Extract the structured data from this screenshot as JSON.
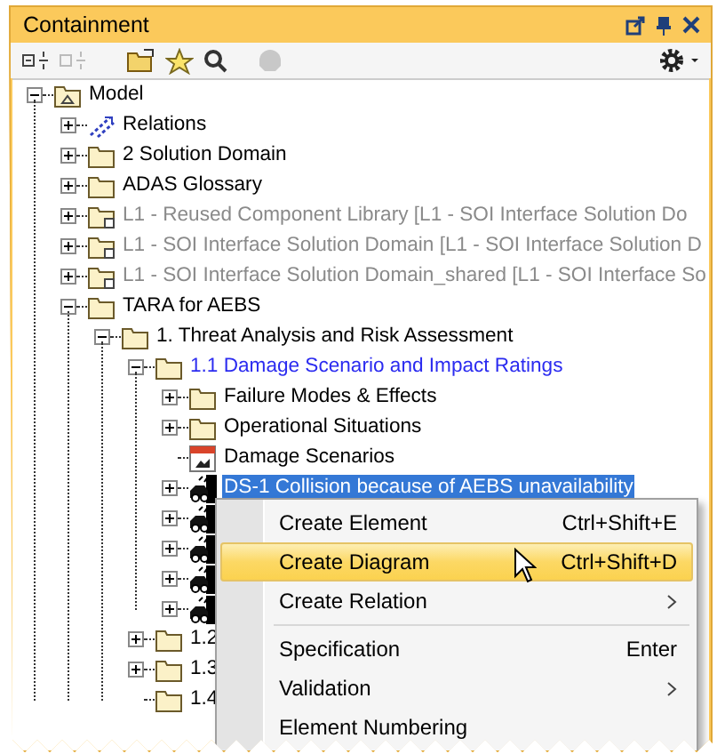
{
  "window": {
    "title": "Containment"
  },
  "tree": [
    {
      "label": "Model",
      "kind": "model",
      "expanded": true,
      "selected": false,
      "greyed": false,
      "emphasized": false,
      "children": [
        {
          "label": "Relations",
          "kind": "relations",
          "expanded": false,
          "selected": false,
          "greyed": false,
          "emphasized": false
        },
        {
          "label": "2 Solution Domain",
          "kind": "folder",
          "expanded": false,
          "selected": false,
          "greyed": false,
          "emphasized": false
        },
        {
          "label": "ADAS Glossary",
          "kind": "folder",
          "expanded": false,
          "selected": false,
          "greyed": false,
          "emphasized": false
        },
        {
          "label": "L1 - Reused Component Library [L1 - SOI Interface Solution Do",
          "kind": "shared-folder",
          "expanded": false,
          "selected": false,
          "greyed": true,
          "emphasized": false
        },
        {
          "label": "L1 - SOI Interface Solution Domain [L1 - SOI Interface Solution D",
          "kind": "shared-folder",
          "expanded": false,
          "selected": false,
          "greyed": true,
          "emphasized": false
        },
        {
          "label": "L1 - SOI Interface Solution Domain_shared [L1 - SOI Interface So",
          "kind": "shared-folder",
          "expanded": false,
          "selected": false,
          "greyed": true,
          "emphasized": false
        },
        {
          "label": "TARA for AEBS",
          "kind": "folder",
          "expanded": true,
          "selected": false,
          "greyed": false,
          "emphasized": false,
          "children": [
            {
              "label": "1. Threat Analysis and Risk Assessment",
              "kind": "folder",
              "expanded": true,
              "selected": false,
              "greyed": false,
              "emphasized": false,
              "children": [
                {
                  "label": "1.1 Damage Scenario and Impact Ratings",
                  "kind": "folder",
                  "expanded": true,
                  "selected": false,
                  "greyed": false,
                  "emphasized": true,
                  "children": [
                    {
                      "label": "Failure Modes & Effects",
                      "kind": "folder",
                      "expanded": false,
                      "selected": false,
                      "greyed": false,
                      "emphasized": false
                    },
                    {
                      "label": "Operational Situations",
                      "kind": "folder",
                      "expanded": false,
                      "selected": false,
                      "greyed": false,
                      "emphasized": false
                    },
                    {
                      "label": "Damage Scenarios",
                      "kind": "table",
                      "selected": false,
                      "greyed": false,
                      "emphasized": false
                    },
                    {
                      "label": "DS-1 Collision because of AEBS unavailability",
                      "kind": "scenario",
                      "expanded": false,
                      "selected": true,
                      "greyed": false,
                      "emphasized": false
                    },
                    {
                      "kind": "scenario",
                      "expanded": false,
                      "selected": false
                    },
                    {
                      "kind": "scenario",
                      "expanded": false,
                      "selected": false
                    },
                    {
                      "kind": "scenario",
                      "expanded": false,
                      "selected": false
                    },
                    {
                      "kind": "scenario",
                      "expanded": false,
                      "selected": false
                    }
                  ]
                },
                {
                  "label": "1.2",
                  "kind": "folder",
                  "expanded": false,
                  "selected": false,
                  "greyed": false,
                  "emphasized": false
                },
                {
                  "label": "1.3",
                  "kind": "folder",
                  "expanded": false,
                  "selected": false,
                  "greyed": false,
                  "emphasized": false
                },
                {
                  "label": "1.4",
                  "kind": "folder",
                  "selected": false,
                  "greyed": false,
                  "emphasized": false
                }
              ]
            }
          ]
        }
      ]
    }
  ],
  "context_menu": {
    "items": [
      {
        "kind": "item",
        "label": "Create Element",
        "shortcut": "Ctrl+Shift+E",
        "submenu": false,
        "selected": false
      },
      {
        "kind": "item",
        "label": "Create Diagram",
        "shortcut": "Ctrl+Shift+D",
        "submenu": false,
        "selected": true
      },
      {
        "kind": "item",
        "label": "Create Relation",
        "submenu": true,
        "selected": false
      },
      {
        "kind": "separator"
      },
      {
        "kind": "item",
        "label": "Specification",
        "shortcut": "Enter",
        "submenu": false,
        "selected": false
      },
      {
        "kind": "item",
        "label": "Validation",
        "submenu": true,
        "selected": false
      },
      {
        "kind": "item",
        "label": "Element Numbering",
        "submenu": false,
        "selected": false
      }
    ]
  }
}
